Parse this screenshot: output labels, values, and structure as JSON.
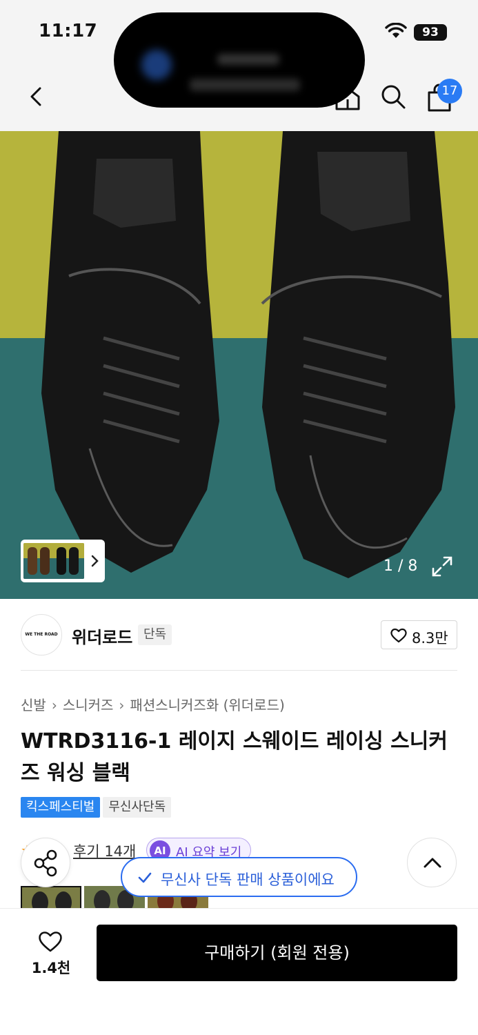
{
  "status_bar": {
    "time": "11:17",
    "battery": "93"
  },
  "header": {
    "cart_count": "17"
  },
  "gallery": {
    "counter": "1 / 8"
  },
  "brand": {
    "logo_text": "WE THE ROAD",
    "name": "위더로드",
    "tag": "단독",
    "likes": "8.3만"
  },
  "product": {
    "breadcrumb": [
      "신발",
      "스니커즈",
      "패션스니커즈화 (위더로드)"
    ],
    "title": "WTRD3116-1 레이지 스웨이드 레이싱 스니커즈 워싱 블랙",
    "tags": [
      "킥스페스티벌",
      "무신사단독"
    ],
    "review_count": "후기 14개",
    "ai_badge": "AI",
    "ai_summary_label": "AI 요약 보기",
    "exclusive_notice": "무신사 단독 판매 상품이에요"
  },
  "bottom_bar": {
    "wish_count": "1.4천",
    "buy_label": "구매하기 (회원 전용)"
  },
  "colors": {
    "accent_blue": "#2a86f0",
    "ai_purple": "#7a4ee0",
    "buy_black": "#000000"
  },
  "icons": [
    "back-icon",
    "home-icon",
    "search-icon",
    "cart-icon",
    "expand-icon",
    "heart-icon",
    "share-icon",
    "chevron-up-icon",
    "check-icon",
    "wifi-icon"
  ]
}
